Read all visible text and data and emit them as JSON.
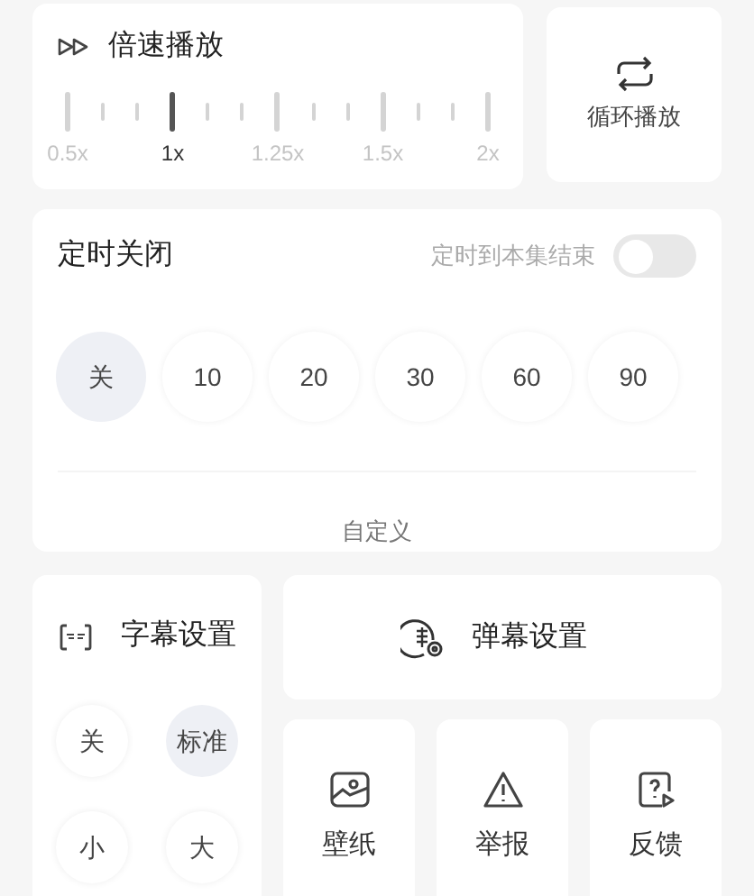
{
  "speed": {
    "title": "倍速播放",
    "options": [
      {
        "label": "0.5x",
        "selected": false
      },
      {
        "label": "1x",
        "selected": true
      },
      {
        "label": "1.25x",
        "selected": false
      },
      {
        "label": "1.5x",
        "selected": false
      },
      {
        "label": "2x",
        "selected": false
      }
    ]
  },
  "loop": {
    "label": "循环播放"
  },
  "timer": {
    "title": "定时关闭",
    "end_of_episode": {
      "label": "定时到本集结束",
      "on": false
    },
    "options": [
      {
        "label": "关",
        "selected": true
      },
      {
        "label": "10",
        "selected": false
      },
      {
        "label": "20",
        "selected": false
      },
      {
        "label": "30",
        "selected": false
      },
      {
        "label": "60",
        "selected": false
      },
      {
        "label": "90",
        "selected": false
      }
    ],
    "custom": "自定义"
  },
  "subtitle": {
    "title": "字幕设置",
    "options": [
      {
        "label": "关",
        "selected": false
      },
      {
        "label": "标准",
        "selected": true
      },
      {
        "label": "小",
        "selected": false
      },
      {
        "label": "大",
        "selected": false
      }
    ]
  },
  "danmaku": {
    "label": "弹幕设置"
  },
  "actions": [
    {
      "kind": "wallpaper",
      "label": "壁纸"
    },
    {
      "kind": "report",
      "label": "举报"
    },
    {
      "kind": "feedback",
      "label": "反馈"
    }
  ]
}
